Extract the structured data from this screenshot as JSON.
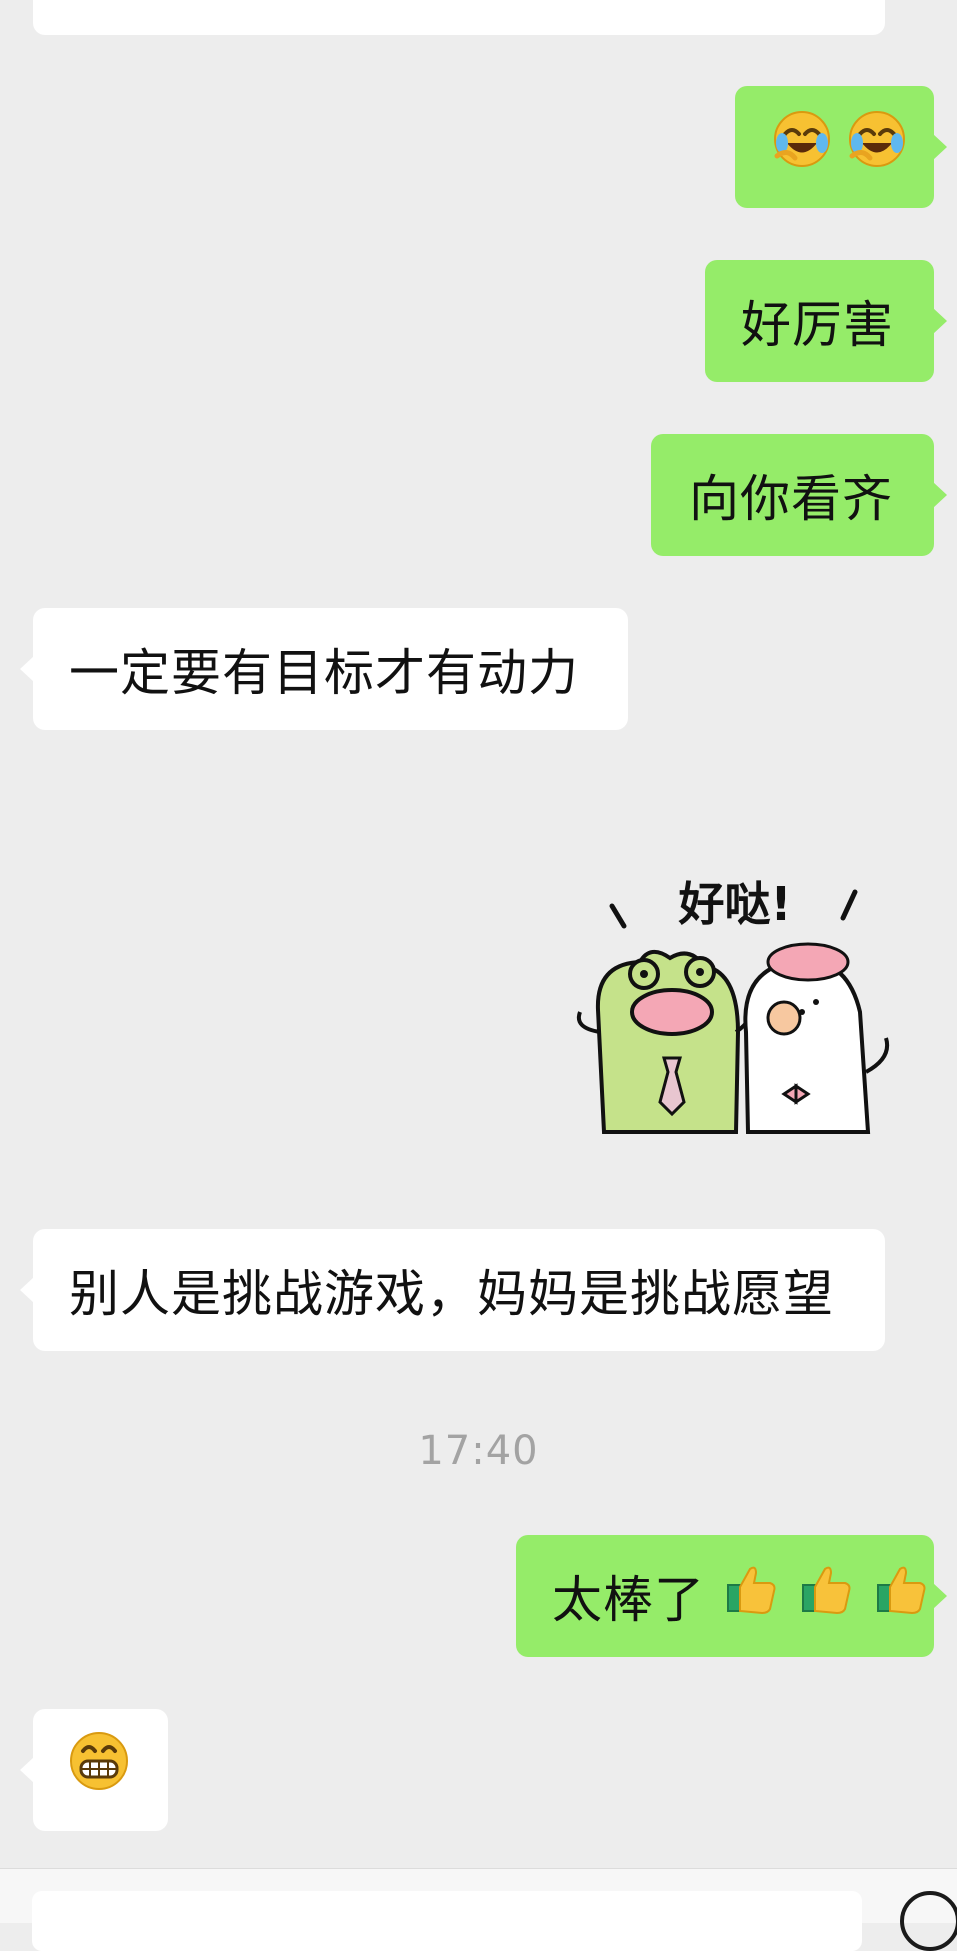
{
  "messages": [
    {
      "side": "in",
      "text": ""
    },
    {
      "side": "out",
      "text": "",
      "emoji": [
        "face-with-tears-of-joy",
        "face-with-tears-of-joy"
      ]
    },
    {
      "side": "out",
      "text": "好厉害"
    },
    {
      "side": "out",
      "text": "向你看齐"
    },
    {
      "side": "in",
      "text": "一定要有目标才有动力"
    },
    {
      "side": "out",
      "sticker_text": "好哒!"
    },
    {
      "side": "in",
      "text": "别人是挑战游戏，妈妈是挑战愿望"
    },
    {
      "side": "out",
      "text": "太棒了",
      "emoji": [
        "thumbs-up",
        "thumbs-up",
        "thumbs-up"
      ]
    },
    {
      "side": "in",
      "text": "",
      "emoji": [
        "grinning-face"
      ]
    }
  ],
  "timestamp": "17:40",
  "colors": {
    "background": "#ededed",
    "incoming_bubble": "#ffffff",
    "outgoing_bubble": "#95ec69",
    "timestamp_text": "#a3a3a3"
  }
}
